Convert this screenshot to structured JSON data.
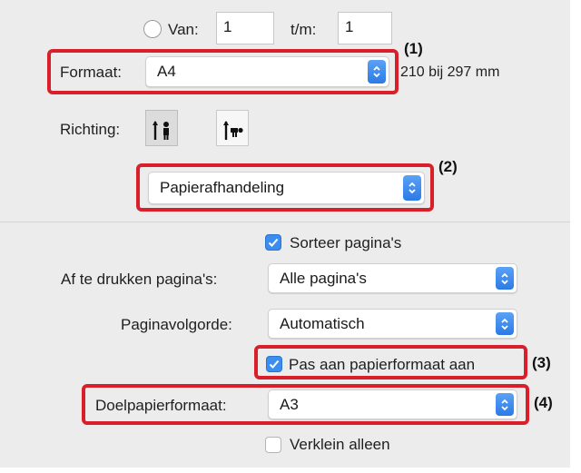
{
  "pages": {
    "van_label": "Van:",
    "van_value": "1",
    "tm_label": "t/m:",
    "tm_value": "1"
  },
  "format": {
    "label": "Formaat:",
    "value": "A4",
    "size_text": "210 bij 297 mm"
  },
  "orientation": {
    "label": "Richting:"
  },
  "section": {
    "value": "Papierafhandeling"
  },
  "collate": {
    "label": "Sorteer pagina's",
    "checked": true
  },
  "pages_to_print": {
    "label": "Af te drukken pagina's:",
    "value": "Alle pagina's"
  },
  "page_order": {
    "label": "Paginavolgorde:",
    "value": "Automatisch"
  },
  "scale_to_paper": {
    "label": "Pas aan papierformaat aan",
    "checked": true
  },
  "dest_paper": {
    "label": "Doelpapierformaat:",
    "value": "A3"
  },
  "scale_down_only": {
    "label": "Verklein alleen",
    "checked": false
  },
  "callouts": [
    "(1)",
    "(2)",
    "(3)",
    "(4)"
  ],
  "colors": {
    "highlight": "#d9202a",
    "accent": "#3b8ef0"
  }
}
